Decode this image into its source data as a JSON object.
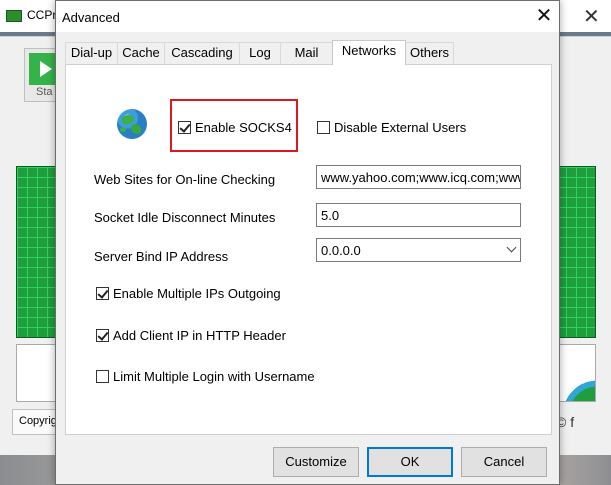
{
  "background_app": {
    "title": "CCPro",
    "start_label": "Sta",
    "copyright_label": "Copyrig",
    "social_icons": "© f"
  },
  "dialog": {
    "title": "Advanced",
    "close_glyph": "✕",
    "tabs": [
      "Dial-up",
      "Cache",
      "Cascading",
      "Log",
      "Mail",
      "Networks",
      "Others"
    ],
    "active_tab": "Networks"
  },
  "networks": {
    "enable_socks4": {
      "label": "Enable SOCKS4",
      "checked": true
    },
    "disable_external_users": {
      "label": "Disable External Users",
      "checked": false
    },
    "web_sites_label": "Web Sites for On-line Checking",
    "web_sites_value": "www.yahoo.com;www.icq.com;www",
    "socket_idle_label": "Socket Idle Disconnect Minutes",
    "socket_idle_value": "5.0",
    "server_bind_label": "Server Bind IP Address",
    "server_bind_value": "0.0.0.0",
    "enable_multiple_ips": {
      "label": "Enable Multiple IPs Outgoing",
      "checked": true
    },
    "add_client_ip": {
      "label": "Add Client IP in HTTP Header",
      "checked": true
    },
    "limit_multiple_login": {
      "label": "Limit Multiple Login with Username",
      "checked": false
    }
  },
  "buttons": {
    "customize": "Customize",
    "ok": "OK",
    "cancel": "Cancel"
  },
  "colors": {
    "highlight": "#e0181d",
    "default_button_border": "#0078d7"
  }
}
